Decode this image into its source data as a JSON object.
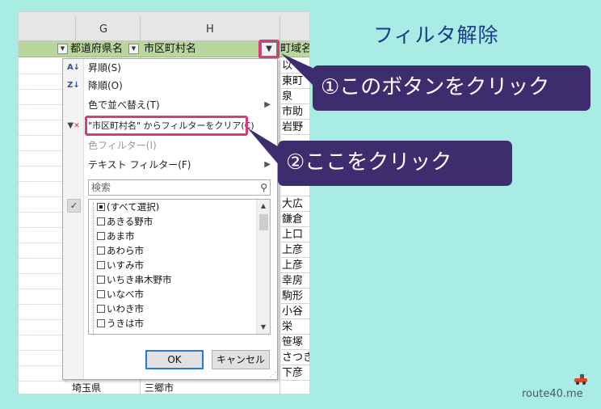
{
  "annotation": {
    "title": "フィルタ解除",
    "callout1": "①このボタンをクリック",
    "callout2": "②ここをクリック",
    "brand": "route40.me"
  },
  "sheet": {
    "col_g": "G",
    "col_h": "H",
    "header_g": "都道府県名",
    "header_h": "市区町村名",
    "header_i": "町域名",
    "right_cells": [
      "以",
      "東町",
      "泉",
      "市助",
      "岩野",
      "",
      "",
      "",
      "",
      "大広",
      "鎌倉",
      "上口",
      "上彦",
      "上彦",
      "幸房",
      "駒形",
      "小谷",
      "栄",
      "笹塚",
      "さつき",
      "下彦"
    ],
    "bottom_g": "埼玉県",
    "bottom_h": "三郷市"
  },
  "menu": {
    "sort_asc": "昇順(S)",
    "sort_desc": "降順(O)",
    "sort_color": "色で並べ替え(T)",
    "clear_filter": "\"市区町村名\" からフィルターをクリア(C)",
    "color_filter": "色フィルター(I)",
    "text_filter": "テキスト フィルター(F)",
    "search_placeholder": "検索",
    "items": [
      "(すべて選択)",
      "あきる野市",
      "あま市",
      "あわら市",
      "いすみ市",
      "いちき串木野市",
      "いなべ市",
      "いわき市",
      "うきは市"
    ],
    "ok": "OK",
    "cancel": "キャンセル"
  }
}
